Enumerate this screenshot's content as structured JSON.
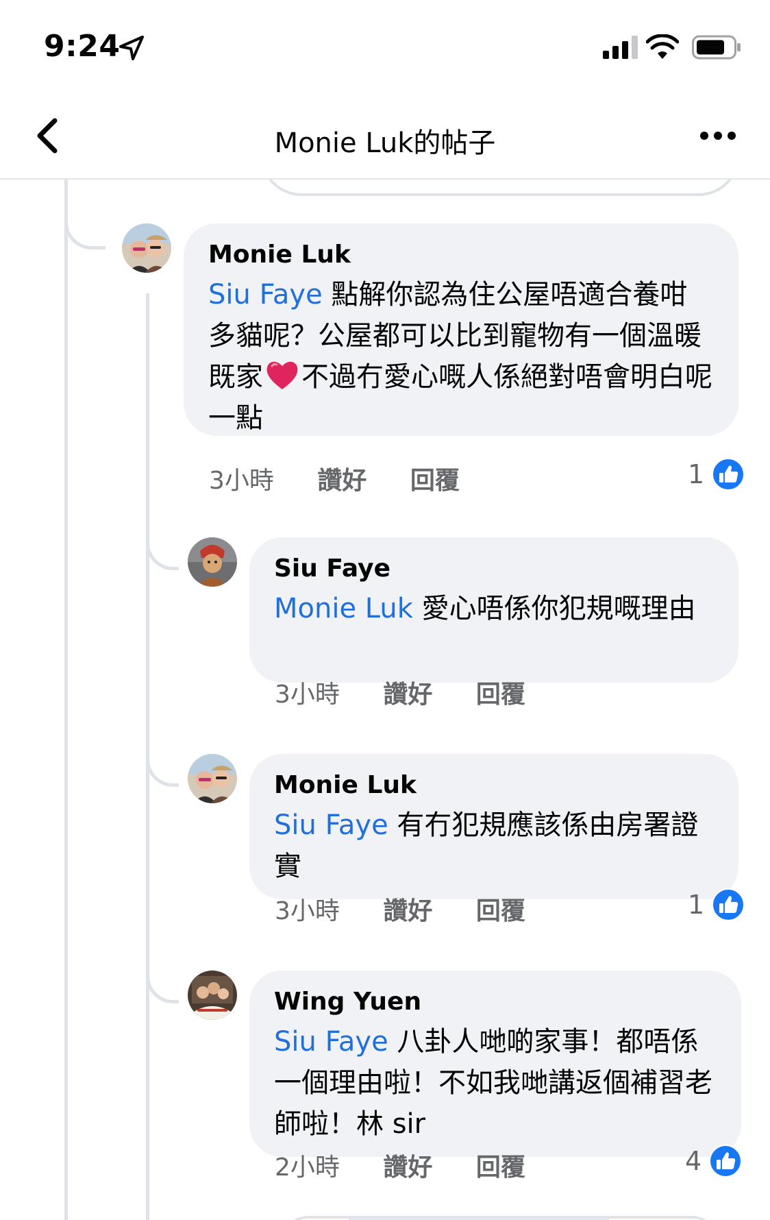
{
  "status_bar": {
    "time": "9:24"
  },
  "header": {
    "title": "Monie Luk的帖子"
  },
  "comments": [
    {
      "author": "Monie Luk",
      "mention": "Siu Faye",
      "text_before_heart": " 點解你認為住公屋唔適合養咁多貓呢？公屋都可以比到寵物有一個溫暖既家",
      "text_after_heart": "不過冇愛心嘅人係絕對唔會明白呢一點",
      "time": "3小時",
      "like_label": "讚好",
      "reply_label": "回覆",
      "reactions": "1"
    },
    {
      "author": "Siu Faye",
      "mention": "Monie Luk",
      "text": " 愛心唔係你犯規嘅理由",
      "time": "3小時",
      "like_label": "讚好",
      "reply_label": "回覆"
    },
    {
      "author": "Monie Luk",
      "mention": "Siu Faye",
      "text": " 有冇犯規應該係由房署證實",
      "time": "3小時",
      "like_label": "讚好",
      "reply_label": "回覆",
      "reactions": "1"
    },
    {
      "author": "Wing Yuen",
      "mention": "Siu Faye",
      "text": " 八卦人哋啲家事！都唔係一個理由啦！不如我哋講返個補習老師啦！林 sir",
      "time": "2小時",
      "like_label": "讚好",
      "reply_label": "回覆",
      "reactions": "4"
    }
  ],
  "colors": {
    "mention": "#216fdb",
    "like_blue": "#1877f2",
    "bubble": "#f0f2f5",
    "meta": "#65676b"
  },
  "icons": [
    "location-arrow-icon",
    "signal-icon",
    "wifi-icon",
    "battery-icon",
    "back-chevron-icon",
    "more-icon",
    "heart-emoji-icon",
    "like-reaction-icon"
  ]
}
